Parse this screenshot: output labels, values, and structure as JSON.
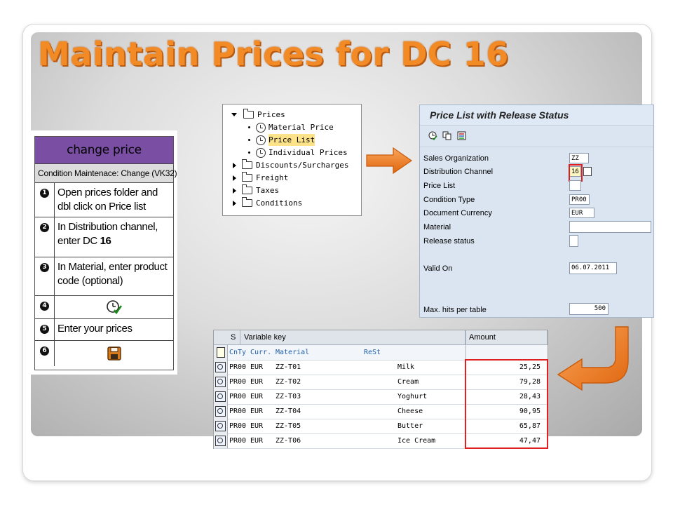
{
  "slide": {
    "title": "Maintain Prices for DC 16"
  },
  "card": {
    "header": "change price",
    "subheader": "Condition Maintenace: Change (VK32)",
    "steps": [
      {
        "num": "1",
        "text": "Open prices folder and dbl click on Price list"
      },
      {
        "num": "2",
        "text_a": "In Distribution channel, enter  DC ",
        "text_b": "16"
      },
      {
        "num": "3",
        "text": "In Material, enter product code (optional)"
      },
      {
        "num": "4",
        "icon": "execute-clock-icon"
      },
      {
        "num": "5",
        "text": "Enter your  prices"
      },
      {
        "num": "6",
        "icon": "save-floppy-icon"
      }
    ]
  },
  "tree": {
    "items": [
      {
        "label": "Prices",
        "type": "folder-open"
      },
      {
        "label": "Material Price",
        "type": "leaf"
      },
      {
        "label": "Price List",
        "type": "leaf",
        "highlighted": true
      },
      {
        "label": "Individual Prices",
        "type": "leaf"
      },
      {
        "label": "Discounts/Surcharges",
        "type": "folder"
      },
      {
        "label": "Freight",
        "type": "folder"
      },
      {
        "label": "Taxes",
        "type": "folder"
      },
      {
        "label": "Conditions",
        "type": "folder"
      }
    ]
  },
  "selection_screen": {
    "title": "Price List with Release Status",
    "fields": [
      {
        "label": "Sales Organization",
        "value": "ZZ"
      },
      {
        "label": "Distribution Channel",
        "value": "16"
      },
      {
        "label": "Price List",
        "value": ""
      },
      {
        "label": "Condition Type",
        "value": "PR00"
      },
      {
        "label": "Document Currency",
        "value": "EUR"
      },
      {
        "label": "Material",
        "value": ""
      },
      {
        "label": "Release status",
        "value": ""
      },
      {
        "label": "Valid On",
        "value": "06.07.2011"
      },
      {
        "label": "Max. hits per table",
        "value": "500"
      }
    ]
  },
  "results_table": {
    "headers": {
      "s": "S",
      "key": "Variable key",
      "amount": "Amount"
    },
    "subheader": {
      "cnty": "CnTy",
      "curr": "Curr.",
      "material": "Material",
      "rest": "ReSt"
    },
    "rows": [
      {
        "cnty": "PR00",
        "curr": "EUR",
        "material": "ZZ-T01",
        "desc": "Milk",
        "amount": "25,25"
      },
      {
        "cnty": "PR00",
        "curr": "EUR",
        "material": "ZZ-T02",
        "desc": "Cream",
        "amount": "79,28"
      },
      {
        "cnty": "PR00",
        "curr": "EUR",
        "material": "ZZ-T03",
        "desc": "Yoghurt",
        "amount": "28,43"
      },
      {
        "cnty": "PR00",
        "curr": "EUR",
        "material": "ZZ-T04",
        "desc": "Cheese",
        "amount": "90,95"
      },
      {
        "cnty": "PR00",
        "curr": "EUR",
        "material": "ZZ-T05",
        "desc": "Butter",
        "amount": "65,87"
      },
      {
        "cnty": "PR00",
        "curr": "EUR",
        "material": "ZZ-T06",
        "desc": "Ice Cream",
        "amount": "47,47"
      }
    ]
  },
  "colors": {
    "title_orange": "#f28b25",
    "card_header_purple": "#7a4fa3",
    "highlight_red": "#e02020",
    "arrow_orange": "#f07d1f"
  }
}
